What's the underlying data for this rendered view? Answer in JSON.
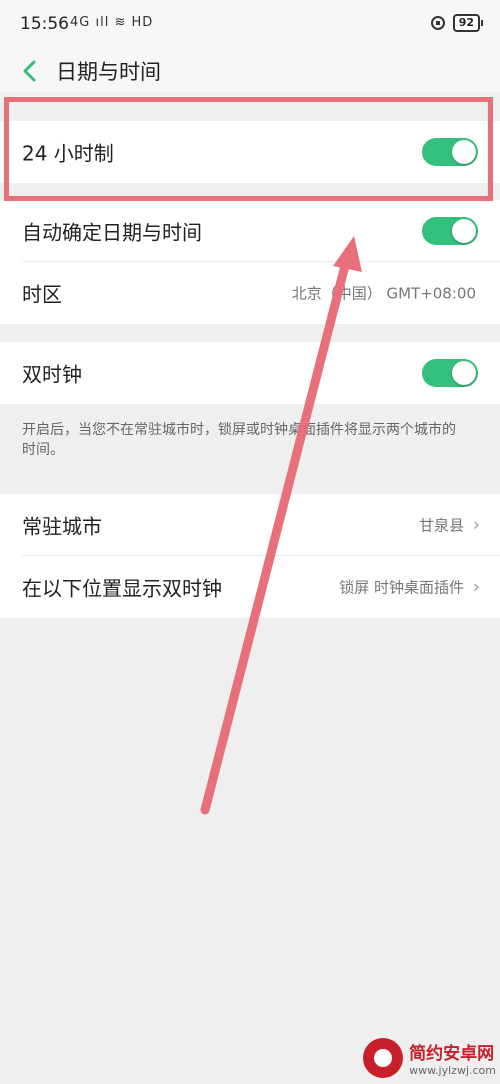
{
  "status_bar": {
    "time": "15:56",
    "signal_icons": "4G ıll ≋ HD",
    "battery": "92"
  },
  "header": {
    "title": "日期与时间"
  },
  "settings": {
    "hour24": {
      "label": "24 小时制",
      "enabled": true
    },
    "auto_datetime": {
      "label": "自动确定日期与时间",
      "enabled": true
    },
    "timezone": {
      "label": "时区",
      "value": "北京（中国） GMT+08:00"
    },
    "dual_clock": {
      "label": "双时钟",
      "enabled": true
    },
    "dual_clock_note": "开启后，当您不在常驻城市时，锁屏或时钟桌面插件将显示两个城市的时间。",
    "home_city": {
      "label": "常驻城市",
      "value": "甘泉县"
    },
    "dual_clock_location": {
      "label": "在以下位置显示双时钟",
      "value": "锁屏 时钟桌面插件"
    }
  },
  "watermark": {
    "name": "简约安卓网",
    "url": "www.jylzwj.com"
  },
  "colors": {
    "toggle_on": "#35bf7c",
    "annotation": "#e8707a",
    "back_arrow": "#35bf7c"
  }
}
